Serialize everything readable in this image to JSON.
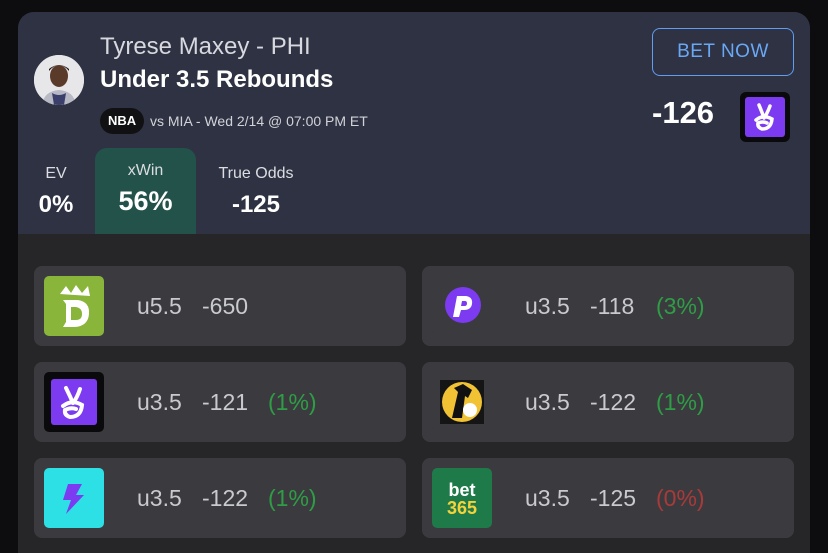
{
  "player": {
    "name": "Tyrese Maxey - PHI",
    "prop": "Under 3.5 Rebounds",
    "league": "NBA",
    "game_info": "vs MIA - Wed 2/14 @ 07:00 PM ET"
  },
  "actions": {
    "bet_now": "BET NOW"
  },
  "best": {
    "odds": "-126",
    "book_icon": "fliff-icon"
  },
  "stats": {
    "ev": {
      "label": "EV",
      "value": "0%"
    },
    "xwin": {
      "label": "xWin",
      "value": "56%"
    },
    "true_odds": {
      "label": "True Odds",
      "value": "-125"
    }
  },
  "books": [
    {
      "icon": "draftkings-icon",
      "line": "u5.5",
      "odds": "-650",
      "pct": ""
    },
    {
      "icon": "prizepicks-icon",
      "line": "u3.5",
      "odds": "-118",
      "pct": "(3%)"
    },
    {
      "icon": "fliff-icon",
      "line": "u3.5",
      "odds": "-121",
      "pct": "(1%)"
    },
    {
      "icon": "betr-icon",
      "line": "u3.5",
      "odds": "-122",
      "pct": "(1%)"
    },
    {
      "icon": "underdog-icon",
      "line": "u3.5",
      "odds": "-122",
      "pct": "(1%)"
    },
    {
      "icon": "bet365-icon",
      "line": "u3.5",
      "odds": "-125",
      "pct": "(0%)"
    }
  ],
  "logo_text": {
    "bet365_top": "bet",
    "bet365_bottom": "365"
  },
  "colors": {
    "header_bg": "#2e3243",
    "xwin_bg": "#23524a",
    "bet_now_border": "#5f9ef0",
    "positive": "#2f9d46",
    "negative": "#a83a3a",
    "fliff": "#7c3bf0",
    "draftkings": "#89b53b",
    "underdog": "#2de0e6",
    "bet365": "#1f7a4a"
  }
}
